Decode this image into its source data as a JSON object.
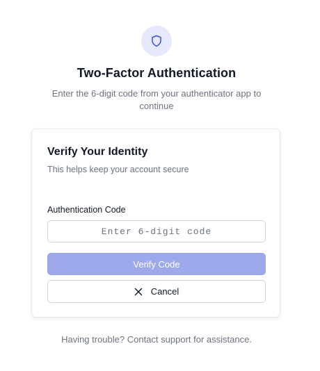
{
  "header": {
    "icon": "shield-icon",
    "title": "Two-Factor Authentication",
    "subtitle": "Enter the 6-digit code from your authenticator app to continue"
  },
  "card": {
    "title": "Verify Your Identity",
    "subtitle": "This helps keep your account secure",
    "code_field": {
      "label": "Authentication Code",
      "value": "",
      "placeholder": "Enter 6-digit code"
    },
    "verify_button": {
      "label": "Verify Code",
      "disabled": true
    },
    "cancel_button": {
      "label": "Cancel",
      "icon": "close-icon"
    }
  },
  "footer": {
    "help_text": "Having trouble? Contact support for assistance."
  },
  "colors": {
    "accent": "#3b4fd8",
    "accent_soft": "#e6e9fb",
    "button_disabled": "#9ea9ec",
    "muted_text": "#6b7280",
    "border": "#d1d5db"
  }
}
